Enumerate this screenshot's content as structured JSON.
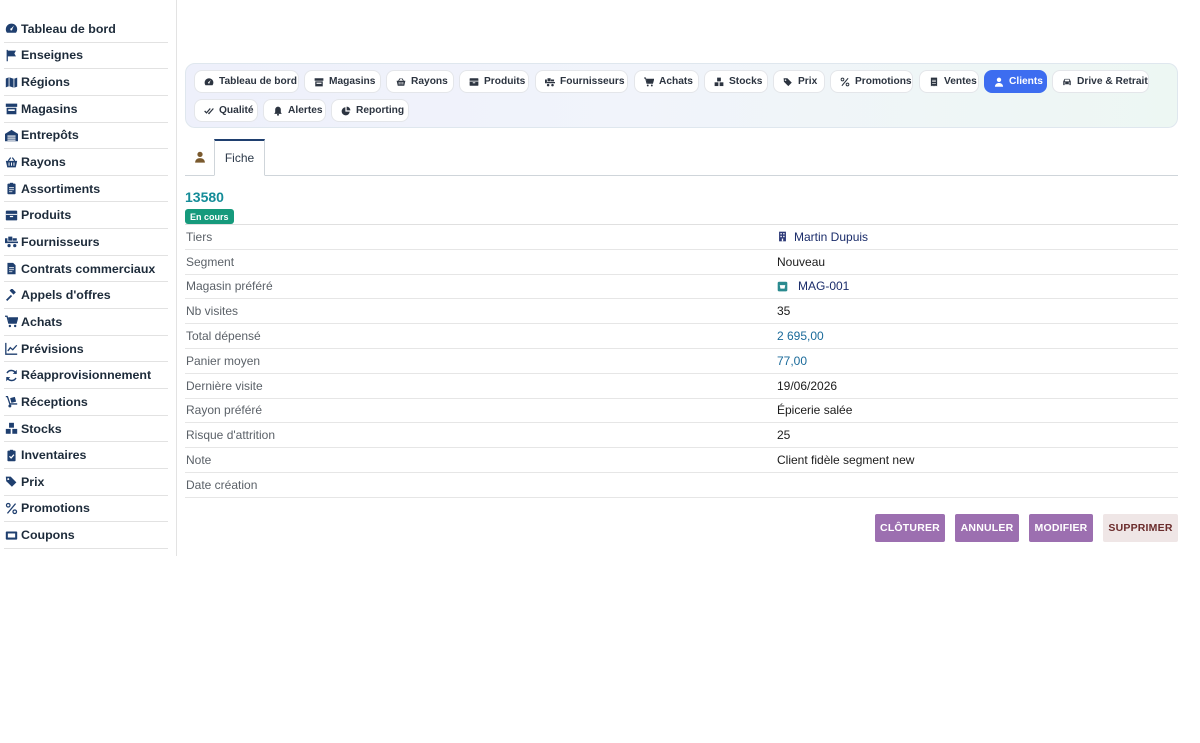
{
  "sidebar": {
    "items": [
      {
        "label": "Tableau de bord",
        "icon": "dashboard-icon"
      },
      {
        "label": "Enseignes",
        "icon": "flag-icon"
      },
      {
        "label": "Régions",
        "icon": "map-icon"
      },
      {
        "label": "Magasins",
        "icon": "store-icon"
      },
      {
        "label": "Entrepôts",
        "icon": "warehouse-icon"
      },
      {
        "label": "Rayons",
        "icon": "basket-icon"
      },
      {
        "label": "Assortiments",
        "icon": "clipboard-icon"
      },
      {
        "label": "Produits",
        "icon": "box-icon"
      },
      {
        "label": "Fournisseurs",
        "icon": "truck-icon"
      },
      {
        "label": "Contrats commerciaux",
        "icon": "contract-icon"
      },
      {
        "label": "Appels d'offres",
        "icon": "gavel-icon"
      },
      {
        "label": "Achats",
        "icon": "cart-icon"
      },
      {
        "label": "Prévisions",
        "icon": "chart-line-icon"
      },
      {
        "label": "Réapprovisionnement",
        "icon": "refresh-icon"
      },
      {
        "label": "Réceptions",
        "icon": "dolly-icon"
      },
      {
        "label": "Stocks",
        "icon": "boxes-icon"
      },
      {
        "label": "Inventaires",
        "icon": "clipboard-check-icon"
      },
      {
        "label": "Prix",
        "icon": "tags-icon"
      },
      {
        "label": "Promotions",
        "icon": "percent-icon"
      },
      {
        "label": "Coupons",
        "icon": "ticket-icon"
      }
    ]
  },
  "modules": {
    "items": [
      {
        "label": "Tableau de bord",
        "icon": "dashboard-icon",
        "active": false
      },
      {
        "label": "Magasins",
        "icon": "store-icon",
        "active": false
      },
      {
        "label": "Rayons",
        "icon": "basket-icon",
        "active": false
      },
      {
        "label": "Produits",
        "icon": "box-icon",
        "active": false
      },
      {
        "label": "Fournisseurs",
        "icon": "truck-icon",
        "active": false
      },
      {
        "label": "Achats",
        "icon": "cart-icon",
        "active": false
      },
      {
        "label": "Stocks",
        "icon": "boxes-icon",
        "active": false
      },
      {
        "label": "Prix",
        "icon": "tags-icon",
        "active": false
      },
      {
        "label": "Promotions",
        "icon": "percent-icon",
        "active": false
      },
      {
        "label": "Ventes",
        "icon": "receipt-icon",
        "active": false
      },
      {
        "label": "Clients",
        "icon": "user-icon",
        "active": true
      },
      {
        "label": "Drive & Retrait",
        "icon": "car-icon",
        "active": false
      },
      {
        "label": "Qualité",
        "icon": "check-double-icon",
        "active": false
      },
      {
        "label": "Alertes",
        "icon": "bell-icon",
        "active": false
      },
      {
        "label": "Reporting",
        "icon": "pie-chart-icon",
        "active": false
      }
    ]
  },
  "tabs": {
    "fiche_label": "Fiche"
  },
  "record": {
    "id": "13580",
    "status": "En cours"
  },
  "fields": [
    {
      "label": "Tiers",
      "value": "Martin Dupuis",
      "icon": "building-icon",
      "kind": "link"
    },
    {
      "label": "Segment",
      "value": "Nouveau",
      "kind": "text"
    },
    {
      "label": "Magasin préféré",
      "value": "MAG-001",
      "icon": "store-badge-icon",
      "kind": "link"
    },
    {
      "label": "Nb visites",
      "value": "35",
      "kind": "text"
    },
    {
      "label": "Total dépensé",
      "value": "2 695,00",
      "kind": "num"
    },
    {
      "label": "Panier moyen",
      "value": "77,00",
      "kind": "num"
    },
    {
      "label": "Dernière visite",
      "value": "19/06/2026",
      "kind": "text"
    },
    {
      "label": "Rayon préféré",
      "value": "Épicerie salée",
      "kind": "text"
    },
    {
      "label": "Risque d'attrition",
      "value": "25",
      "kind": "text"
    },
    {
      "label": "Note",
      "value": "Client fidèle segment new",
      "kind": "text"
    },
    {
      "label": "Date création",
      "value": "",
      "kind": "text"
    }
  ],
  "actions": {
    "cloturer": "CLÔTURER",
    "annuler": "ANNULER",
    "modifier": "MODIFIER",
    "supprimer": "SUPPRIMER"
  },
  "colors": {
    "accent": "#3d6df0",
    "record_id": "#148c98",
    "status_badge": "#169a7c",
    "action_purple": "#9c6fb0",
    "action_danger_bg": "#efe6e6"
  }
}
